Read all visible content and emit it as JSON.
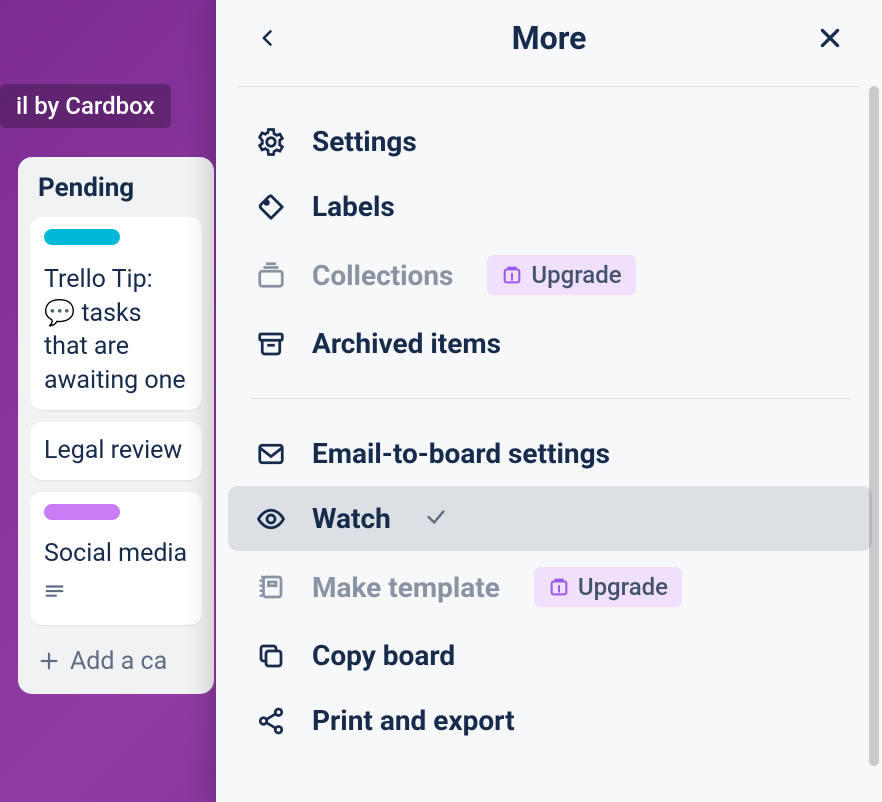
{
  "top_tag": "il by Cardbox",
  "list": {
    "title": "Pending",
    "card1": "Trello Tip: 💬 tasks that are awaiting one",
    "card2": "Legal review",
    "card3": "Social media",
    "add": "Add a ca"
  },
  "panel": {
    "title": "More",
    "menu": {
      "settings": "Settings",
      "labels": "Labels",
      "collections": "Collections",
      "archived": "Archived items",
      "email": "Email-to-board settings",
      "watch": "Watch",
      "make_template": "Make template",
      "copy_board": "Copy board",
      "print_export": "Print and export"
    },
    "upgrade": "Upgrade"
  }
}
